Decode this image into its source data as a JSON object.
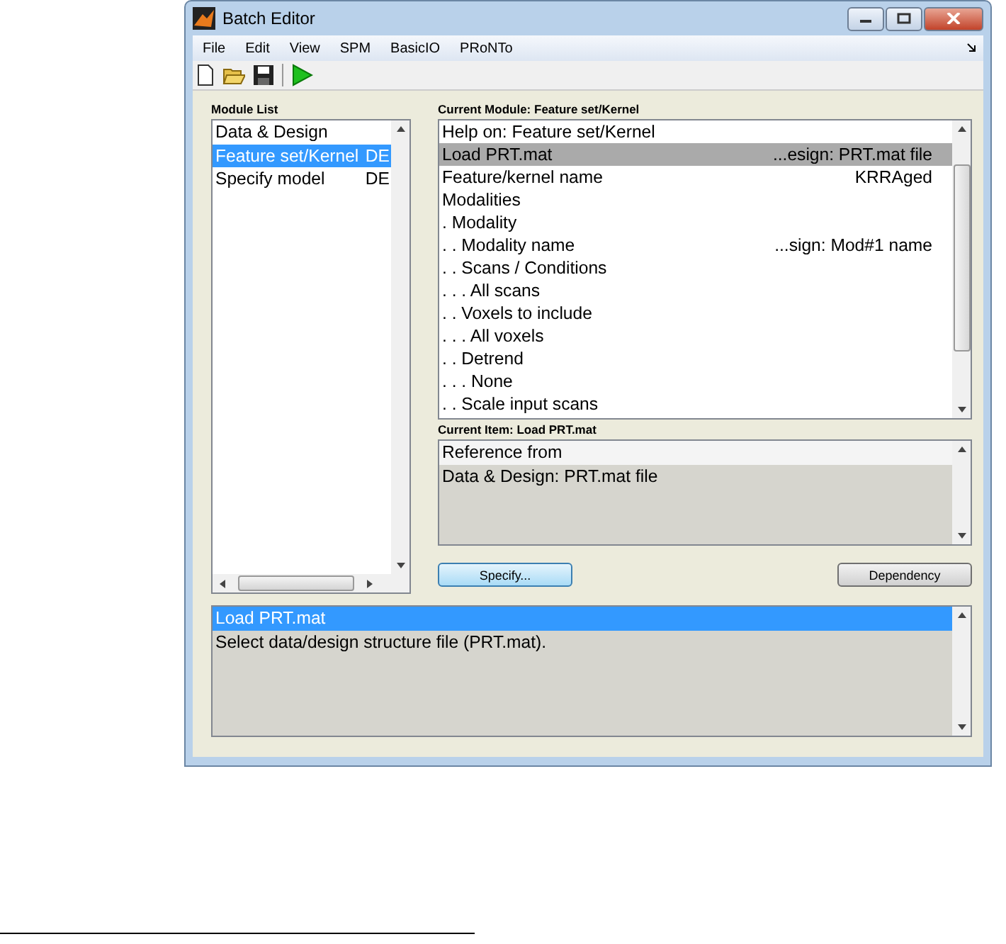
{
  "window": {
    "title": "Batch Editor"
  },
  "menu": [
    "File",
    "Edit",
    "View",
    "SPM",
    "BasicIO",
    "PRoNTo"
  ],
  "module_list": {
    "label": "Module List",
    "items": [
      {
        "name": "Data & Design",
        "value": "",
        "selected": false
      },
      {
        "name": "Feature set/Kernel",
        "value": "DE",
        "selected": true
      },
      {
        "name": "Specify model",
        "value": "DE",
        "selected": false
      }
    ]
  },
  "current_module": {
    "label": "Current Module: Feature set/Kernel",
    "rows": [
      {
        "name": "Help on: Feature set/Kernel",
        "value": "",
        "selected": false
      },
      {
        "name": "Load PRT.mat",
        "value": "...esign: PRT.mat file",
        "selected": true
      },
      {
        "name": "Feature/kernel name",
        "value": "KRRAged",
        "selected": false
      },
      {
        "name": "Modalities",
        "value": "",
        "selected": false
      },
      {
        "name": ". Modality",
        "value": "",
        "selected": false
      },
      {
        "name": ". . Modality name",
        "value": "...sign: Mod#1 name",
        "selected": false
      },
      {
        "name": ". . Scans / Conditions",
        "value": "",
        "selected": false
      },
      {
        "name": ". . . All scans",
        "value": "",
        "selected": false
      },
      {
        "name": ". . Voxels to include",
        "value": "",
        "selected": false
      },
      {
        "name": ". . . All voxels",
        "value": "",
        "selected": false
      },
      {
        "name": ". . Detrend",
        "value": "",
        "selected": false
      },
      {
        "name": ". . . None",
        "value": "",
        "selected": false
      },
      {
        "name": ". . Scale input scans",
        "value": "",
        "selected": false
      }
    ]
  },
  "current_item": {
    "label": "Current Item: Load PRT.mat",
    "rows": [
      {
        "text": "Reference from",
        "selected": true
      },
      {
        "text": "Data & Design: PRT.mat file",
        "selected": false
      }
    ]
  },
  "buttons": [
    {
      "label": "Specify...",
      "kind": "primary"
    },
    {
      "label": "Dependency",
      "kind": "normal"
    }
  ],
  "help": [
    {
      "text": "Load PRT.mat",
      "selected": true
    },
    {
      "text": "Select data/design structure file (PRT.mat).",
      "selected": false
    }
  ]
}
